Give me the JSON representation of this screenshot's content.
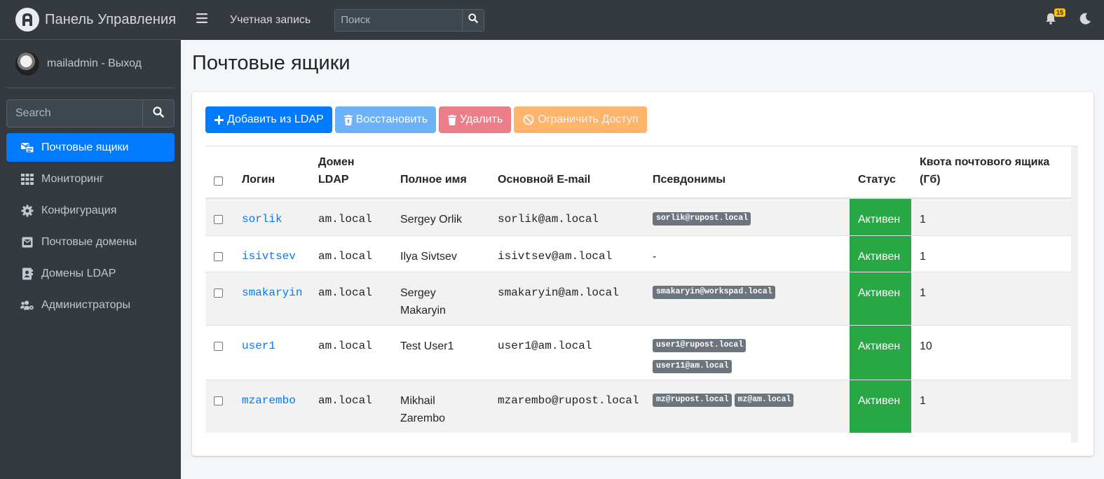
{
  "app": {
    "title": "Панель Управления"
  },
  "user": {
    "link": "mailadmin - Выход"
  },
  "sidebar": {
    "search_placeholder": "Search",
    "items": [
      {
        "label": "Почтовые ящики",
        "icon": "mailbox-icon",
        "active": true
      },
      {
        "label": "Мониторинг",
        "icon": "grid-icon",
        "active": false
      },
      {
        "label": "Конфигурация",
        "icon": "gear-icon",
        "active": false
      },
      {
        "label": "Почтовые домены",
        "icon": "envelope-square-icon",
        "active": false
      },
      {
        "label": "Домены LDAP",
        "icon": "address-book-icon",
        "active": false
      },
      {
        "label": "Администраторы",
        "icon": "users-cog-icon",
        "active": false
      }
    ]
  },
  "topbar": {
    "account_link": "Учетная запись",
    "search_placeholder": "Поиск",
    "notifications_count": "15"
  },
  "main": {
    "title": "Почтовые ящики",
    "buttons": {
      "add": "Добавить из LDAP",
      "restore": "Восстановить",
      "delete": "Удалить",
      "restrict": "Ограничить Доступ"
    },
    "table": {
      "headers": {
        "login": "Логин",
        "domain": "Домен LDAP",
        "fullname": "Полное имя",
        "email": "Основной E-mail",
        "aliases": "Псевдонимы",
        "status": "Статус",
        "quota": "Квота почтового ящика (Гб)"
      },
      "rows": [
        {
          "login": "sorlik",
          "domain": "am.local",
          "fullname": "Sergey Orlik",
          "email": "sorlik@am.local",
          "aliases": [
            "sorlik@rupost.local"
          ],
          "aliases_text": "",
          "status": "Активен",
          "quota": "1"
        },
        {
          "login": "isivtsev",
          "domain": "am.local",
          "fullname": "Ilya Sivtsev",
          "email": "isivtsev@am.local",
          "aliases": [],
          "aliases_text": "-",
          "status": "Активен",
          "quota": "1"
        },
        {
          "login": "smakaryin",
          "domain": "am.local",
          "fullname": "Sergey Makaryin",
          "email": "smakaryin@am.local",
          "aliases": [
            "smakaryin@workspad.local"
          ],
          "aliases_text": "",
          "status": "Активен",
          "quota": "1"
        },
        {
          "login": "user1",
          "domain": "am.local",
          "fullname": "Test User1",
          "email": "user1@am.local",
          "aliases": [
            "user1@rupost.local",
            "user11@am.local"
          ],
          "aliases_text": "",
          "status": "Активен",
          "quota": "10"
        },
        {
          "login": "mzarembo",
          "domain": "am.local",
          "fullname": "Mikhail Zarembo",
          "email": "mzarembo@rupost.local",
          "aliases": [
            "mz@rupost.local",
            "mz@am.local"
          ],
          "aliases_text": "",
          "status": "Активен",
          "quota": "1"
        }
      ]
    }
  },
  "colors": {
    "sidebar_bg": "#343a40",
    "primary": "#007bff",
    "success": "#28a745",
    "info_disabled": "#6cb2f9",
    "danger_disabled": "#ec7e89",
    "warning_disabled": "#feb46a",
    "badge_gray": "#6c757d"
  }
}
